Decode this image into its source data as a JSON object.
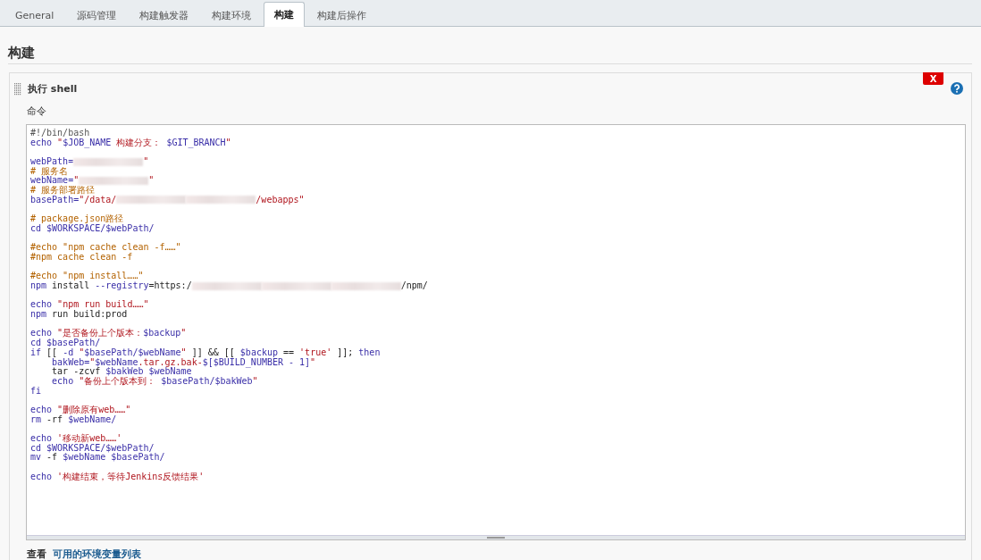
{
  "tabs": [
    {
      "label": "General",
      "selected": false
    },
    {
      "label": "源码管理",
      "selected": false
    },
    {
      "label": "构建触发器",
      "selected": false
    },
    {
      "label": "构建环境",
      "selected": false
    },
    {
      "label": "构建",
      "selected": true
    },
    {
      "label": "构建后操作",
      "selected": false
    }
  ],
  "section": {
    "title": "构建"
  },
  "step": {
    "title": "执行 shell",
    "delete_label": "X",
    "field_label": "命令",
    "code": [
      {
        "kind": "code",
        "indented": false,
        "tokens": [
          {
            "text": "#!/bin/bash",
            "kind": "shebang"
          }
        ]
      },
      {
        "kind": "code",
        "indented": false,
        "tokens": [
          {
            "text": "echo ",
            "kind": "keyword"
          },
          {
            "text": "\"",
            "kind": "string"
          },
          {
            "text": "$JOB_NAME",
            "kind": "keyword"
          },
          {
            "text": " 构建分支： ",
            "kind": "string"
          },
          {
            "text": "$GIT_BRANCH",
            "kind": "keyword"
          },
          {
            "text": "\"",
            "kind": "string"
          }
        ]
      },
      {
        "kind": "blank"
      },
      {
        "kind": "code",
        "indented": false,
        "tokens": [
          {
            "text": "webPath=",
            "kind": "keyword"
          },
          {
            "kind": "redacted"
          },
          {
            "text": "\"",
            "kind": "string"
          }
        ]
      },
      {
        "kind": "code",
        "indented": false,
        "tokens": [
          {
            "text": "# 服务名",
            "kind": "comment"
          }
        ]
      },
      {
        "kind": "code",
        "indented": false,
        "tokens": [
          {
            "text": "webName=",
            "kind": "keyword"
          },
          {
            "text": "\"",
            "kind": "string"
          },
          {
            "kind": "redacted"
          },
          {
            "text": "\"",
            "kind": "string"
          }
        ]
      },
      {
        "kind": "code",
        "indented": false,
        "tokens": [
          {
            "text": "# 服务部署路径",
            "kind": "comment"
          }
        ]
      },
      {
        "kind": "code",
        "indented": false,
        "tokens": [
          {
            "text": "basePath=",
            "kind": "keyword"
          },
          {
            "text": "\"/data/",
            "kind": "string"
          },
          {
            "kind": "redacted"
          },
          {
            "kind": "redacted"
          },
          {
            "text": "/webapps\"",
            "kind": "string"
          }
        ]
      },
      {
        "kind": "blank"
      },
      {
        "kind": "code",
        "indented": false,
        "tokens": [
          {
            "text": "# package.json路径",
            "kind": "comment"
          }
        ]
      },
      {
        "kind": "code",
        "indented": false,
        "tokens": [
          {
            "text": "cd $WORKSPACE/$webPath/",
            "kind": "keyword"
          }
        ]
      },
      {
        "kind": "blank"
      },
      {
        "kind": "code",
        "indented": false,
        "tokens": [
          {
            "text": "#echo \"npm cache clean -f……\"",
            "kind": "comment"
          }
        ]
      },
      {
        "kind": "code",
        "indented": false,
        "tokens": [
          {
            "text": "#npm cache clean -f",
            "kind": "comment"
          }
        ]
      },
      {
        "kind": "blank"
      },
      {
        "kind": "code",
        "indented": false,
        "tokens": [
          {
            "text": "#echo \"npm install……\"",
            "kind": "comment"
          }
        ]
      },
      {
        "kind": "code",
        "indented": false,
        "tokens": [
          {
            "text": "npm ",
            "kind": "keyword"
          },
          {
            "text": "install ",
            "kind": "plain"
          },
          {
            "text": "--registry",
            "kind": "keyword"
          },
          {
            "text": "=https:/",
            "kind": "plain"
          },
          {
            "kind": "redacted"
          },
          {
            "kind": "redacted"
          },
          {
            "kind": "redacted"
          },
          {
            "text": "/npm/",
            "kind": "plain"
          }
        ]
      },
      {
        "kind": "blank"
      },
      {
        "kind": "code",
        "indented": false,
        "tokens": [
          {
            "text": "echo ",
            "kind": "keyword"
          },
          {
            "text": "\"npm run build……\"",
            "kind": "string"
          }
        ]
      },
      {
        "kind": "code",
        "indented": false,
        "tokens": [
          {
            "text": "npm ",
            "kind": "keyword"
          },
          {
            "text": "run build:prod",
            "kind": "plain"
          }
        ]
      },
      {
        "kind": "blank"
      },
      {
        "kind": "code",
        "indented": false,
        "tokens": [
          {
            "text": "echo ",
            "kind": "keyword"
          },
          {
            "text": "\"是否备份上个版本：",
            "kind": "string"
          },
          {
            "text": "$backup",
            "kind": "keyword"
          },
          {
            "text": "\"",
            "kind": "string"
          }
        ]
      },
      {
        "kind": "code",
        "indented": false,
        "tokens": [
          {
            "text": "cd $basePath/",
            "kind": "keyword"
          }
        ]
      },
      {
        "kind": "code",
        "indented": false,
        "tokens": [
          {
            "text": "if ",
            "kind": "keyword"
          },
          {
            "text": "[[ ",
            "kind": "plain"
          },
          {
            "text": "-d ",
            "kind": "keyword"
          },
          {
            "text": "\"",
            "kind": "string"
          },
          {
            "text": "$basePath/$webName",
            "kind": "keyword"
          },
          {
            "text": "\"",
            "kind": "string"
          },
          {
            "text": " ]] && [[ ",
            "kind": "plain"
          },
          {
            "text": "$backup",
            "kind": "keyword"
          },
          {
            "text": " == ",
            "kind": "plain"
          },
          {
            "text": "'true'",
            "kind": "string"
          },
          {
            "text": " ]]; ",
            "kind": "plain"
          },
          {
            "text": "then",
            "kind": "keyword"
          }
        ]
      },
      {
        "kind": "code",
        "indented": true,
        "tokens": [
          {
            "text": "bakWeb=",
            "kind": "keyword"
          },
          {
            "text": "\"",
            "kind": "string"
          },
          {
            "text": "$webName",
            "kind": "keyword"
          },
          {
            "text": ".tar.gz.bak-",
            "kind": "string"
          },
          {
            "text": "$[$BUILD_NUMBER - 1]",
            "kind": "keyword"
          },
          {
            "text": "\"",
            "kind": "string"
          }
        ]
      },
      {
        "kind": "code",
        "indented": true,
        "tokens": [
          {
            "text": "tar -zcvf ",
            "kind": "plain"
          },
          {
            "text": "$bakWeb $webName",
            "kind": "keyword"
          }
        ]
      },
      {
        "kind": "code",
        "indented": true,
        "tokens": [
          {
            "text": "echo ",
            "kind": "keyword"
          },
          {
            "text": "\"备份上个版本到： ",
            "kind": "string"
          },
          {
            "text": "$basePath/$bakWeb",
            "kind": "keyword"
          },
          {
            "text": "\"",
            "kind": "string"
          }
        ]
      },
      {
        "kind": "code",
        "indented": false,
        "tokens": [
          {
            "text": "fi",
            "kind": "keyword"
          }
        ]
      },
      {
        "kind": "blank"
      },
      {
        "kind": "code",
        "indented": false,
        "tokens": [
          {
            "text": "echo ",
            "kind": "keyword"
          },
          {
            "text": "\"删除原有web……\"",
            "kind": "string"
          }
        ]
      },
      {
        "kind": "code",
        "indented": false,
        "tokens": [
          {
            "text": "rm ",
            "kind": "keyword"
          },
          {
            "text": "-rf ",
            "kind": "plain"
          },
          {
            "text": "$webName/",
            "kind": "keyword"
          }
        ]
      },
      {
        "kind": "blank"
      },
      {
        "kind": "code",
        "indented": false,
        "tokens": [
          {
            "text": "echo ",
            "kind": "keyword"
          },
          {
            "text": "'移动新web……'",
            "kind": "string"
          }
        ]
      },
      {
        "kind": "code",
        "indented": false,
        "tokens": [
          {
            "text": "cd $WORKSPACE/$webPath/",
            "kind": "keyword"
          }
        ]
      },
      {
        "kind": "code",
        "indented": false,
        "tokens": [
          {
            "text": "mv ",
            "kind": "keyword"
          },
          {
            "text": "-f ",
            "kind": "plain"
          },
          {
            "text": "$webName $basePath/",
            "kind": "keyword"
          }
        ]
      },
      {
        "kind": "blank"
      },
      {
        "kind": "code",
        "indented": false,
        "tokens": [
          {
            "text": "echo ",
            "kind": "keyword"
          },
          {
            "text": "'构建结束，等待Jenkins反馈结果'",
            "kind": "string"
          }
        ]
      }
    ],
    "footer_text": "查看",
    "footer_link": "可用的环境变量列表"
  }
}
